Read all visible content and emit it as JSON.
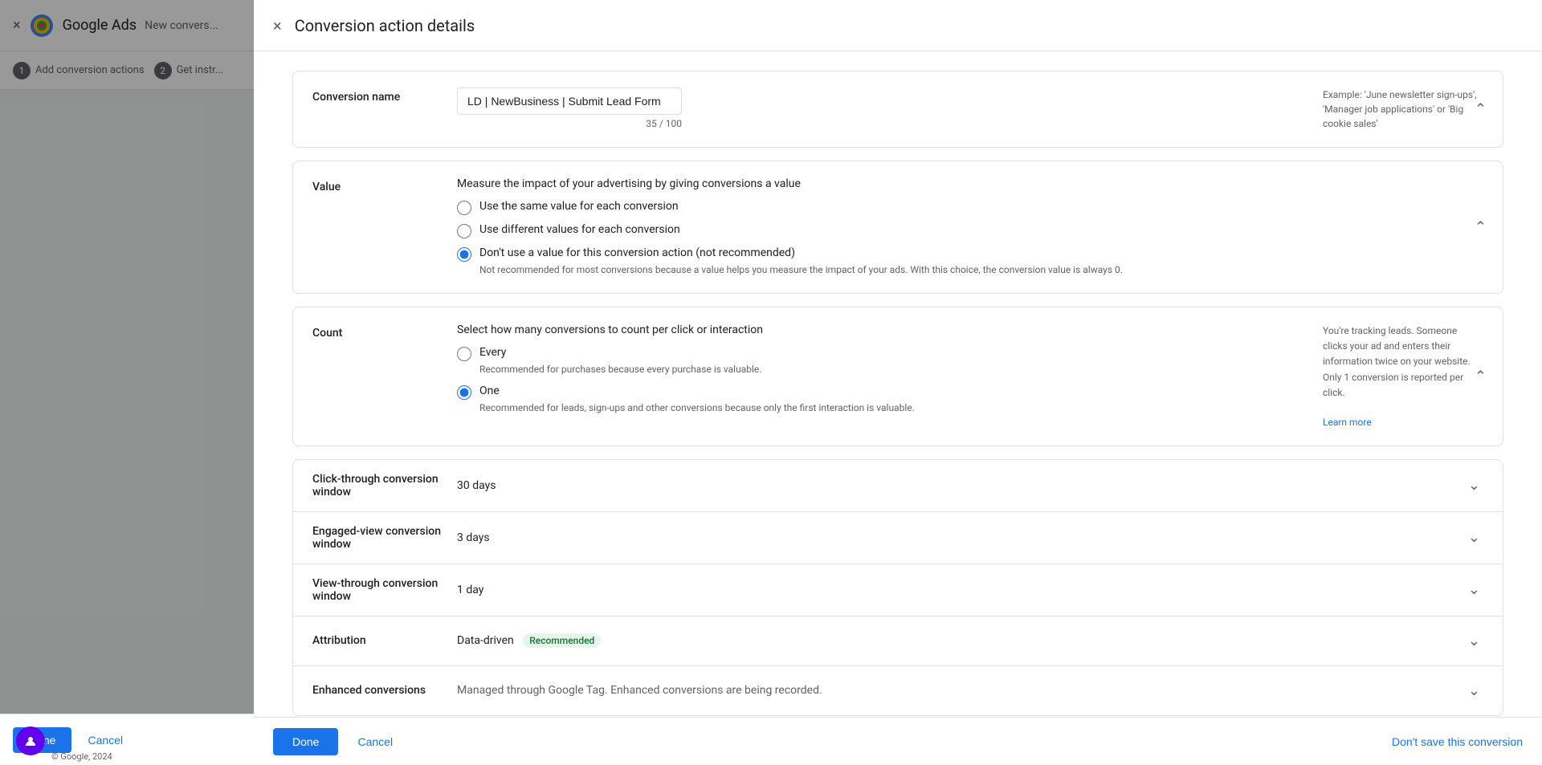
{
  "background": {
    "top_bar": {
      "close_icon": "×",
      "logo_alt": "Google Ads logo",
      "title": "Google Ads",
      "new_conversion_label": "New convers..."
    },
    "steps": [
      {
        "number": "1",
        "label": "Add conversion actions"
      },
      {
        "number": "2",
        "label": "Get instr..."
      }
    ],
    "footer": {
      "done_label": "Done",
      "cancel_label": "Cancel"
    },
    "copyright": "© Google, 2024"
  },
  "one_text": "One",
  "dialog": {
    "title": "Conversion action details",
    "close_icon": "×",
    "sections": {
      "conversion_name": {
        "label": "Conversion name",
        "input_value": "LD | NewBusiness | Submit Lead Form",
        "char_count": "35 / 100",
        "example_text": "Example: 'June newsletter sign-ups', 'Manager job applications' or 'Big cookie sales'"
      },
      "value": {
        "label": "Value",
        "description": "Measure the impact of your advertising by giving conversions a value",
        "options": [
          {
            "id": "same",
            "label": "Use the same value for each conversion",
            "selected": false,
            "sublabel": ""
          },
          {
            "id": "different",
            "label": "Use different values for each conversion",
            "selected": false,
            "sublabel": ""
          },
          {
            "id": "none",
            "label": "Don't use a value for this conversion action (not recommended)",
            "selected": true,
            "sublabel": "Not recommended for most conversions because a value helps you measure the impact of your ads. With this choice, the conversion value is always 0."
          }
        ]
      },
      "count": {
        "label": "Count",
        "description": "Select how many conversions to count per click or interaction",
        "options": [
          {
            "id": "every",
            "label": "Every",
            "selected": false,
            "sublabel": "Recommended for purchases because every purchase is valuable."
          },
          {
            "id": "one",
            "label": "One",
            "selected": true,
            "sublabel": "Recommended for leads, sign-ups and other conversions because only the first interaction is valuable."
          }
        ],
        "aside_text": "You're tracking leads. Someone clicks your ad and enters their information twice on your website. Only 1 conversion is reported per click.",
        "aside_link": "Learn more"
      },
      "click_through": {
        "label": "Click-through conversion window",
        "value": "30 days"
      },
      "engaged_view": {
        "label": "Engaged-view conversion window",
        "value": "3 days"
      },
      "view_through": {
        "label": "View-through conversion window",
        "value": "1 day"
      },
      "attribution": {
        "label": "Attribution",
        "value": "Data-driven",
        "badge": "Recommended"
      },
      "enhanced_conversions": {
        "label": "Enhanced conversions",
        "value": "Managed through Google Tag. Enhanced conversions are being recorded."
      }
    },
    "footer": {
      "done_label": "Done",
      "cancel_label": "Cancel",
      "dont_save_label": "Don't save this conversion"
    }
  },
  "colors": {
    "primary_blue": "#1a73e8",
    "text_primary": "#202124",
    "text_secondary": "#5f6368",
    "border": "#e0e0e0",
    "recommended_bg": "#e6f4ea",
    "recommended_text": "#137333",
    "purple": "#6200ee"
  }
}
